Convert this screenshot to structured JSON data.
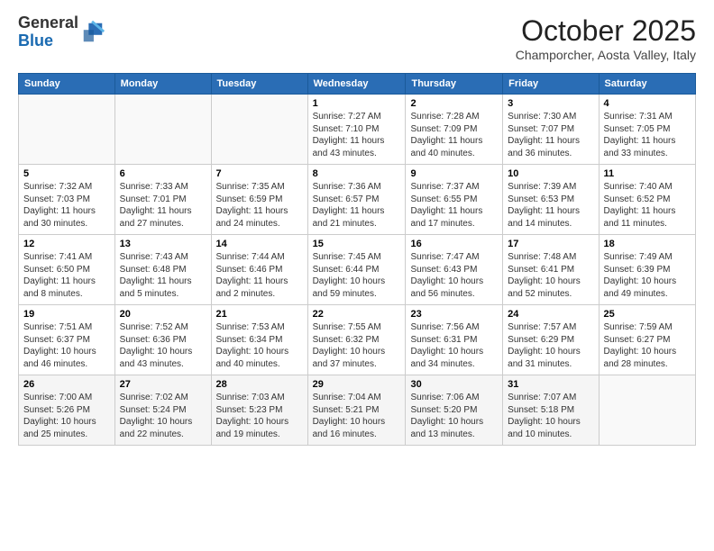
{
  "header": {
    "logo_general": "General",
    "logo_blue": "Blue",
    "month_title": "October 2025",
    "location": "Champorcher, Aosta Valley, Italy"
  },
  "weekdays": [
    "Sunday",
    "Monday",
    "Tuesday",
    "Wednesday",
    "Thursday",
    "Friday",
    "Saturday"
  ],
  "weeks": [
    [
      {
        "day": "",
        "info": ""
      },
      {
        "day": "",
        "info": ""
      },
      {
        "day": "",
        "info": ""
      },
      {
        "day": "1",
        "info": "Sunrise: 7:27 AM\nSunset: 7:10 PM\nDaylight: 11 hours\nand 43 minutes."
      },
      {
        "day": "2",
        "info": "Sunrise: 7:28 AM\nSunset: 7:09 PM\nDaylight: 11 hours\nand 40 minutes."
      },
      {
        "day": "3",
        "info": "Sunrise: 7:30 AM\nSunset: 7:07 PM\nDaylight: 11 hours\nand 36 minutes."
      },
      {
        "day": "4",
        "info": "Sunrise: 7:31 AM\nSunset: 7:05 PM\nDaylight: 11 hours\nand 33 minutes."
      }
    ],
    [
      {
        "day": "5",
        "info": "Sunrise: 7:32 AM\nSunset: 7:03 PM\nDaylight: 11 hours\nand 30 minutes."
      },
      {
        "day": "6",
        "info": "Sunrise: 7:33 AM\nSunset: 7:01 PM\nDaylight: 11 hours\nand 27 minutes."
      },
      {
        "day": "7",
        "info": "Sunrise: 7:35 AM\nSunset: 6:59 PM\nDaylight: 11 hours\nand 24 minutes."
      },
      {
        "day": "8",
        "info": "Sunrise: 7:36 AM\nSunset: 6:57 PM\nDaylight: 11 hours\nand 21 minutes."
      },
      {
        "day": "9",
        "info": "Sunrise: 7:37 AM\nSunset: 6:55 PM\nDaylight: 11 hours\nand 17 minutes."
      },
      {
        "day": "10",
        "info": "Sunrise: 7:39 AM\nSunset: 6:53 PM\nDaylight: 11 hours\nand 14 minutes."
      },
      {
        "day": "11",
        "info": "Sunrise: 7:40 AM\nSunset: 6:52 PM\nDaylight: 11 hours\nand 11 minutes."
      }
    ],
    [
      {
        "day": "12",
        "info": "Sunrise: 7:41 AM\nSunset: 6:50 PM\nDaylight: 11 hours\nand 8 minutes."
      },
      {
        "day": "13",
        "info": "Sunrise: 7:43 AM\nSunset: 6:48 PM\nDaylight: 11 hours\nand 5 minutes."
      },
      {
        "day": "14",
        "info": "Sunrise: 7:44 AM\nSunset: 6:46 PM\nDaylight: 11 hours\nand 2 minutes."
      },
      {
        "day": "15",
        "info": "Sunrise: 7:45 AM\nSunset: 6:44 PM\nDaylight: 10 hours\nand 59 minutes."
      },
      {
        "day": "16",
        "info": "Sunrise: 7:47 AM\nSunset: 6:43 PM\nDaylight: 10 hours\nand 56 minutes."
      },
      {
        "day": "17",
        "info": "Sunrise: 7:48 AM\nSunset: 6:41 PM\nDaylight: 10 hours\nand 52 minutes."
      },
      {
        "day": "18",
        "info": "Sunrise: 7:49 AM\nSunset: 6:39 PM\nDaylight: 10 hours\nand 49 minutes."
      }
    ],
    [
      {
        "day": "19",
        "info": "Sunrise: 7:51 AM\nSunset: 6:37 PM\nDaylight: 10 hours\nand 46 minutes."
      },
      {
        "day": "20",
        "info": "Sunrise: 7:52 AM\nSunset: 6:36 PM\nDaylight: 10 hours\nand 43 minutes."
      },
      {
        "day": "21",
        "info": "Sunrise: 7:53 AM\nSunset: 6:34 PM\nDaylight: 10 hours\nand 40 minutes."
      },
      {
        "day": "22",
        "info": "Sunrise: 7:55 AM\nSunset: 6:32 PM\nDaylight: 10 hours\nand 37 minutes."
      },
      {
        "day": "23",
        "info": "Sunrise: 7:56 AM\nSunset: 6:31 PM\nDaylight: 10 hours\nand 34 minutes."
      },
      {
        "day": "24",
        "info": "Sunrise: 7:57 AM\nSunset: 6:29 PM\nDaylight: 10 hours\nand 31 minutes."
      },
      {
        "day": "25",
        "info": "Sunrise: 7:59 AM\nSunset: 6:27 PM\nDaylight: 10 hours\nand 28 minutes."
      }
    ],
    [
      {
        "day": "26",
        "info": "Sunrise: 7:00 AM\nSunset: 5:26 PM\nDaylight: 10 hours\nand 25 minutes."
      },
      {
        "day": "27",
        "info": "Sunrise: 7:02 AM\nSunset: 5:24 PM\nDaylight: 10 hours\nand 22 minutes."
      },
      {
        "day": "28",
        "info": "Sunrise: 7:03 AM\nSunset: 5:23 PM\nDaylight: 10 hours\nand 19 minutes."
      },
      {
        "day": "29",
        "info": "Sunrise: 7:04 AM\nSunset: 5:21 PM\nDaylight: 10 hours\nand 16 minutes."
      },
      {
        "day": "30",
        "info": "Sunrise: 7:06 AM\nSunset: 5:20 PM\nDaylight: 10 hours\nand 13 minutes."
      },
      {
        "day": "31",
        "info": "Sunrise: 7:07 AM\nSunset: 5:18 PM\nDaylight: 10 hours\nand 10 minutes."
      },
      {
        "day": "",
        "info": ""
      }
    ]
  ]
}
